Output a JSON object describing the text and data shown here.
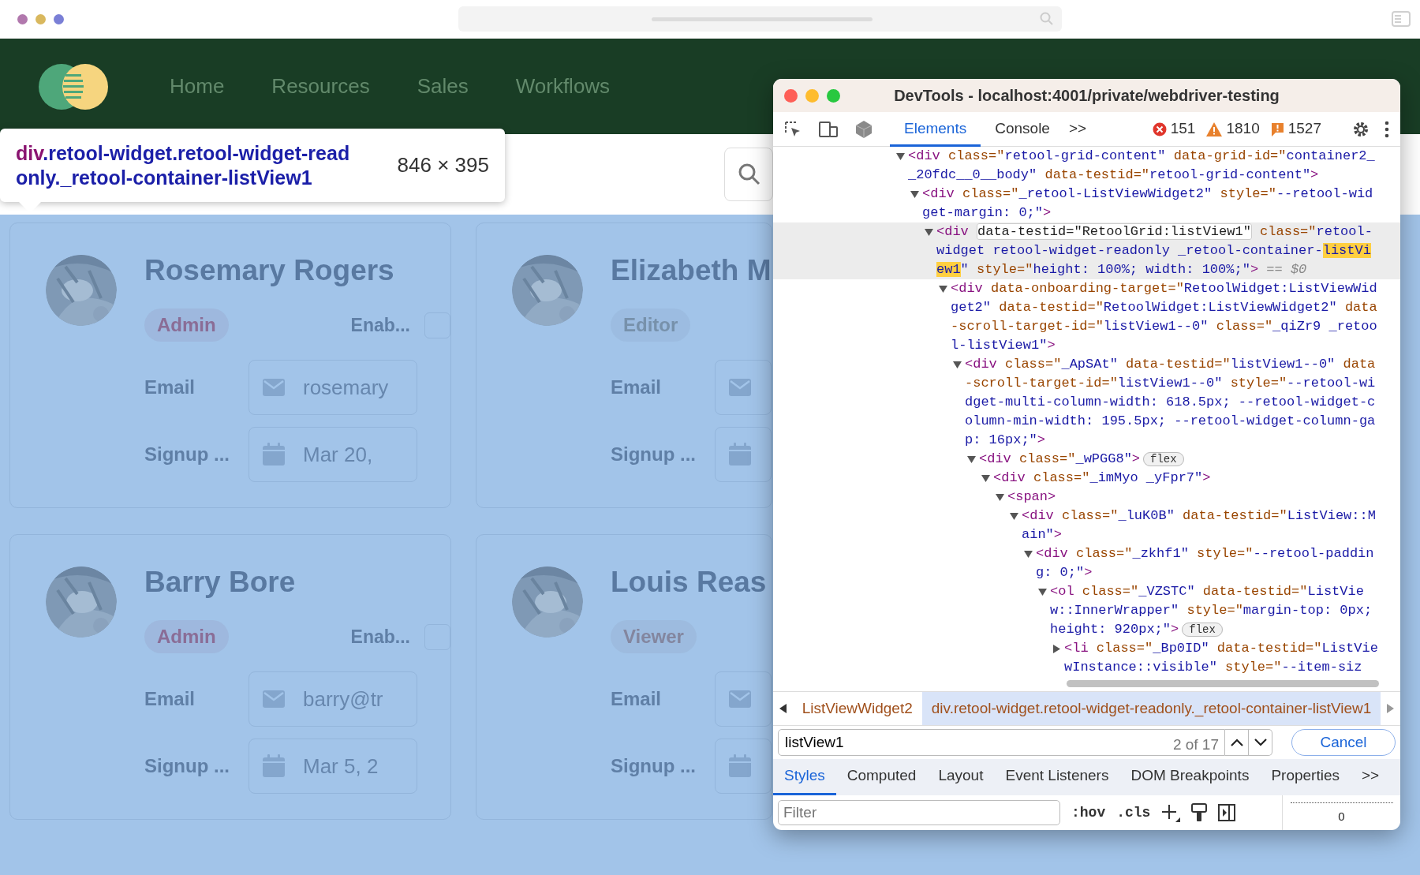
{
  "app": {
    "nav": [
      {
        "label": "Home"
      },
      {
        "label": "Resources"
      },
      {
        "label": "Sales"
      },
      {
        "label": "Workflows"
      }
    ],
    "inspect_tooltip": {
      "tag": "div",
      "selector": ".retool-widget.retool-widget-readonly._retool-container-listView1",
      "size": "846 × 395"
    },
    "cards": [
      {
        "name": "Rosemary Rogers",
        "role": {
          "label": "Admin",
          "color": "#8a6d96"
        },
        "enabled": {
          "label": "Enab...",
          "checked": false
        },
        "email": {
          "label": "Email",
          "value": "rosemary"
        },
        "signup": {
          "label": "Signup ...",
          "value": "Mar 20,"
        }
      },
      {
        "name": "Elizabeth M",
        "role": {
          "label": "Editor",
          "color": "#7791ab"
        },
        "email": {
          "label": "Email"
        },
        "signup": {
          "label": "Signup ..."
        }
      },
      {
        "name": "Barry Bore",
        "role": {
          "label": "Admin",
          "color": "#8a6d96"
        },
        "enabled": {
          "label": "Enab...",
          "checked": false
        },
        "email": {
          "label": "Email",
          "value": "barry@tr"
        },
        "signup": {
          "label": "Signup ...",
          "value": "Mar 5, 2"
        }
      },
      {
        "name": "Louis Reas",
        "role": {
          "label": "Viewer",
          "color": "#83869f"
        },
        "email": {
          "label": "Email"
        },
        "signup": {
          "label": "Signup ..."
        }
      }
    ]
  },
  "devtools": {
    "title": "DevTools - localhost:4001/private/webdriver-testing",
    "tabs": [
      {
        "label": "Elements",
        "selected": true
      },
      {
        "label": "Console",
        "selected": false
      }
    ],
    "tabs_more": ">>",
    "counts": [
      {
        "kind": "error",
        "value": "151"
      },
      {
        "kind": "warning",
        "value": "1810"
      },
      {
        "kind": "issue",
        "value": "1527"
      }
    ],
    "tree": [
      {
        "expanded": true,
        "selected": false,
        "parts": [
          {
            "kind": "tag",
            "text": "<div"
          },
          {
            "kind": "attr",
            "text": " class=\""
          },
          {
            "kind": "value",
            "text": "retool-grid-content\""
          },
          {
            "kind": "attr",
            "text": " data-grid-id=\""
          },
          {
            "kind": "value",
            "text": "container2__20fdc__0__body\""
          },
          {
            "kind": "attr",
            "text": " data-testid=\""
          },
          {
            "kind": "value",
            "text": "retool-grid-content\""
          },
          {
            "kind": "tag",
            "text": ">"
          }
        ],
        "children": [
          {
            "expanded": true,
            "selected": false,
            "parts": [
              {
                "kind": "tag",
                "text": "<div"
              },
              {
                "kind": "attr",
                "text": " class=\""
              },
              {
                "kind": "value",
                "text": "_retool-ListViewWidget2\""
              },
              {
                "kind": "attr",
                "text": " style=\""
              },
              {
                "kind": "value",
                "text": "--retool-widget-margin: 0;\""
              },
              {
                "kind": "tag",
                "text": ">"
              }
            ],
            "children": [
              {
                "expanded": true,
                "selected": true,
                "parts": [
                  {
                    "kind": "tag",
                    "text": "<div "
                  },
                  {
                    "kind": "boxed",
                    "text": "data-testid=\"RetoolGrid:listView1\""
                  },
                  {
                    "kind": "attr",
                    "text": " class=\""
                  },
                  {
                    "kind": "value",
                    "text": "retool-widget retool-widget-readonly _retool-container-"
                  },
                  {
                    "kind": "match",
                    "text": "listView1"
                  },
                  {
                    "kind": "value",
                    "text": "\""
                  },
                  {
                    "kind": "attr",
                    "text": " style=\""
                  },
                  {
                    "kind": "value",
                    "text": "height: 100%; width: 100%;\""
                  },
                  {
                    "kind": "tag",
                    "text": ">"
                  },
                  {
                    "kind": "note",
                    "text": " == $0"
                  }
                ],
                "children": [
                  {
                    "expanded": true,
                    "selected": false,
                    "parts": [
                      {
                        "kind": "tag",
                        "text": "<div"
                      },
                      {
                        "kind": "attr",
                        "text": " data-onboarding-target=\""
                      },
                      {
                        "kind": "value",
                        "text": "RetoolWidget:ListViewWidget2\""
                      },
                      {
                        "kind": "attr",
                        "text": " data-testid=\""
                      },
                      {
                        "kind": "value",
                        "text": "RetoolWidget:ListViewWidget2\""
                      },
                      {
                        "kind": "attr",
                        "text": " data-scroll-target-id=\""
                      },
                      {
                        "kind": "value",
                        "text": "listView1--0\""
                      },
                      {
                        "kind": "attr",
                        "text": " class=\""
                      },
                      {
                        "kind": "value",
                        "text": "_qiZr9 _retool-listView1\""
                      },
                      {
                        "kind": "tag",
                        "text": ">"
                      }
                    ],
                    "children": [
                      {
                        "expanded": true,
                        "selected": false,
                        "parts": [
                          {
                            "kind": "tag",
                            "text": "<div"
                          },
                          {
                            "kind": "attr",
                            "text": " class=\""
                          },
                          {
                            "kind": "value",
                            "text": "_ApSAt\""
                          },
                          {
                            "kind": "attr",
                            "text": " data-testid=\""
                          },
                          {
                            "kind": "value",
                            "text": "listView1--0\""
                          },
                          {
                            "kind": "attr",
                            "text": " data-scroll-target-id=\""
                          },
                          {
                            "kind": "value",
                            "text": "listView1--0\""
                          },
                          {
                            "kind": "attr",
                            "text": " style=\""
                          },
                          {
                            "kind": "value",
                            "text": "--retool-widget-multi-column-width: 618.5px; --retool-widget-column-min-width: 195.5px; --retool-widget-column-gap: 16px;\""
                          },
                          {
                            "kind": "tag",
                            "text": ">"
                          }
                        ],
                        "children": [
                          {
                            "expanded": true,
                            "selected": false,
                            "parts": [
                              {
                                "kind": "tag",
                                "text": "<div"
                              },
                              {
                                "kind": "attr",
                                "text": " class=\""
                              },
                              {
                                "kind": "value",
                                "text": "_wPGG8\""
                              },
                              {
                                "kind": "tag",
                                "text": ">"
                              },
                              {
                                "kind": "badge",
                                "text": "flex"
                              }
                            ],
                            "children": [
                              {
                                "expanded": true,
                                "selected": false,
                                "parts": [
                                  {
                                    "kind": "tag",
                                    "text": "<div"
                                  },
                                  {
                                    "kind": "attr",
                                    "text": " class=\""
                                  },
                                  {
                                    "kind": "value",
                                    "text": "_imMyo _yFpr7\""
                                  },
                                  {
                                    "kind": "tag",
                                    "text": ">"
                                  }
                                ],
                                "children": [
                                  {
                                    "expanded": true,
                                    "selected": false,
                                    "parts": [
                                      {
                                        "kind": "tag",
                                        "text": "<span>"
                                      }
                                    ],
                                    "children": [
                                      {
                                        "expanded": true,
                                        "selected": false,
                                        "parts": [
                                          {
                                            "kind": "tag",
                                            "text": "<div"
                                          },
                                          {
                                            "kind": "attr",
                                            "text": " class=\""
                                          },
                                          {
                                            "kind": "value",
                                            "text": "_luK0B\""
                                          },
                                          {
                                            "kind": "attr",
                                            "text": " data-testid=\""
                                          },
                                          {
                                            "kind": "value",
                                            "text": "ListView::Main\""
                                          },
                                          {
                                            "kind": "tag",
                                            "text": ">"
                                          }
                                        ],
                                        "children": [
                                          {
                                            "expanded": true,
                                            "selected": false,
                                            "parts": [
                                              {
                                                "kind": "tag",
                                                "text": "<div"
                                              },
                                              {
                                                "kind": "attr",
                                                "text": " class=\""
                                              },
                                              {
                                                "kind": "value",
                                                "text": "_zkhf1\""
                                              },
                                              {
                                                "kind": "attr",
                                                "text": " style=\""
                                              },
                                              {
                                                "kind": "value",
                                                "text": "--retool-padding: 0;\""
                                              },
                                              {
                                                "kind": "tag",
                                                "text": ">"
                                              }
                                            ],
                                            "children": [
                                              {
                                                "expanded": true,
                                                "selected": false,
                                                "parts": [
                                                  {
                                                    "kind": "tag",
                                                    "text": "<ol"
                                                  },
                                                  {
                                                    "kind": "attr",
                                                    "text": " class=\""
                                                  },
                                                  {
                                                    "kind": "value",
                                                    "text": "_VZSTC\""
                                                  },
                                                  {
                                                    "kind": "attr",
                                                    "text": " data-testid=\""
                                                  },
                                                  {
                                                    "kind": "value",
                                                    "text": "ListView::InnerWrapper\""
                                                  },
                                                  {
                                                    "kind": "attr",
                                                    "text": " style=\""
                                                  },
                                                  {
                                                    "kind": "value",
                                                    "text": "margin-top: 0px; height: 920px;\""
                                                  },
                                                  {
                                                    "kind": "tag",
                                                    "text": ">"
                                                  },
                                                  {
                                                    "kind": "badge",
                                                    "text": "flex"
                                                  }
                                                ],
                                                "children": [
                                                  {
                                                    "expanded": false,
                                                    "selected": false,
                                                    "parts": [
                                                      {
                                                        "kind": "tag",
                                                        "text": "<li"
                                                      },
                                                      {
                                                        "kind": "attr",
                                                        "text": " class=\""
                                                      },
                                                      {
                                                        "kind": "value",
                                                        "text": "_Bp0ID\""
                                                      },
                                                      {
                                                        "kind": "attr",
                                                        "text": " data-testid=\""
                                                      },
                                                      {
                                                        "kind": "value",
                                                        "text": "ListViewInstance::visible\""
                                                      },
                                                      {
                                                        "kind": "attr",
                                                        "text": " style=\""
                                                      },
                                                      {
                                                        "kind": "value",
                                                        "text": "--item-siz"
                                                      }
                                                    ]
                                                  }
                                                ]
                                              }
                                            ]
                                          }
                                        ]
                                      }
                                    ]
                                  }
                                ]
                              }
                            ]
                          }
                        ]
                      }
                    ]
                  }
                ]
              }
            ]
          }
        ]
      }
    ],
    "breadcrumbs": [
      {
        "label": "ListViewWidget2",
        "selected": false
      },
      {
        "label": "div.retool-widget.retool-widget-readonly._retool-container-listView1",
        "selected": true
      }
    ],
    "search": {
      "value": "listView1",
      "matches": "2 of 17",
      "cancel": "Cancel"
    },
    "subtabs": [
      {
        "label": "Styles",
        "selected": true
      },
      {
        "label": "Computed",
        "selected": false
      },
      {
        "label": "Layout",
        "selected": false
      },
      {
        "label": "Event Listeners",
        "selected": false
      },
      {
        "label": "DOM Breakpoints",
        "selected": false
      },
      {
        "label": "Properties",
        "selected": false
      }
    ],
    "subtabs_more": ">>",
    "filter": {
      "placeholder": "Filter"
    },
    "style_buttons": [
      ":hov",
      ".cls"
    ],
    "box_model_value": "0"
  }
}
